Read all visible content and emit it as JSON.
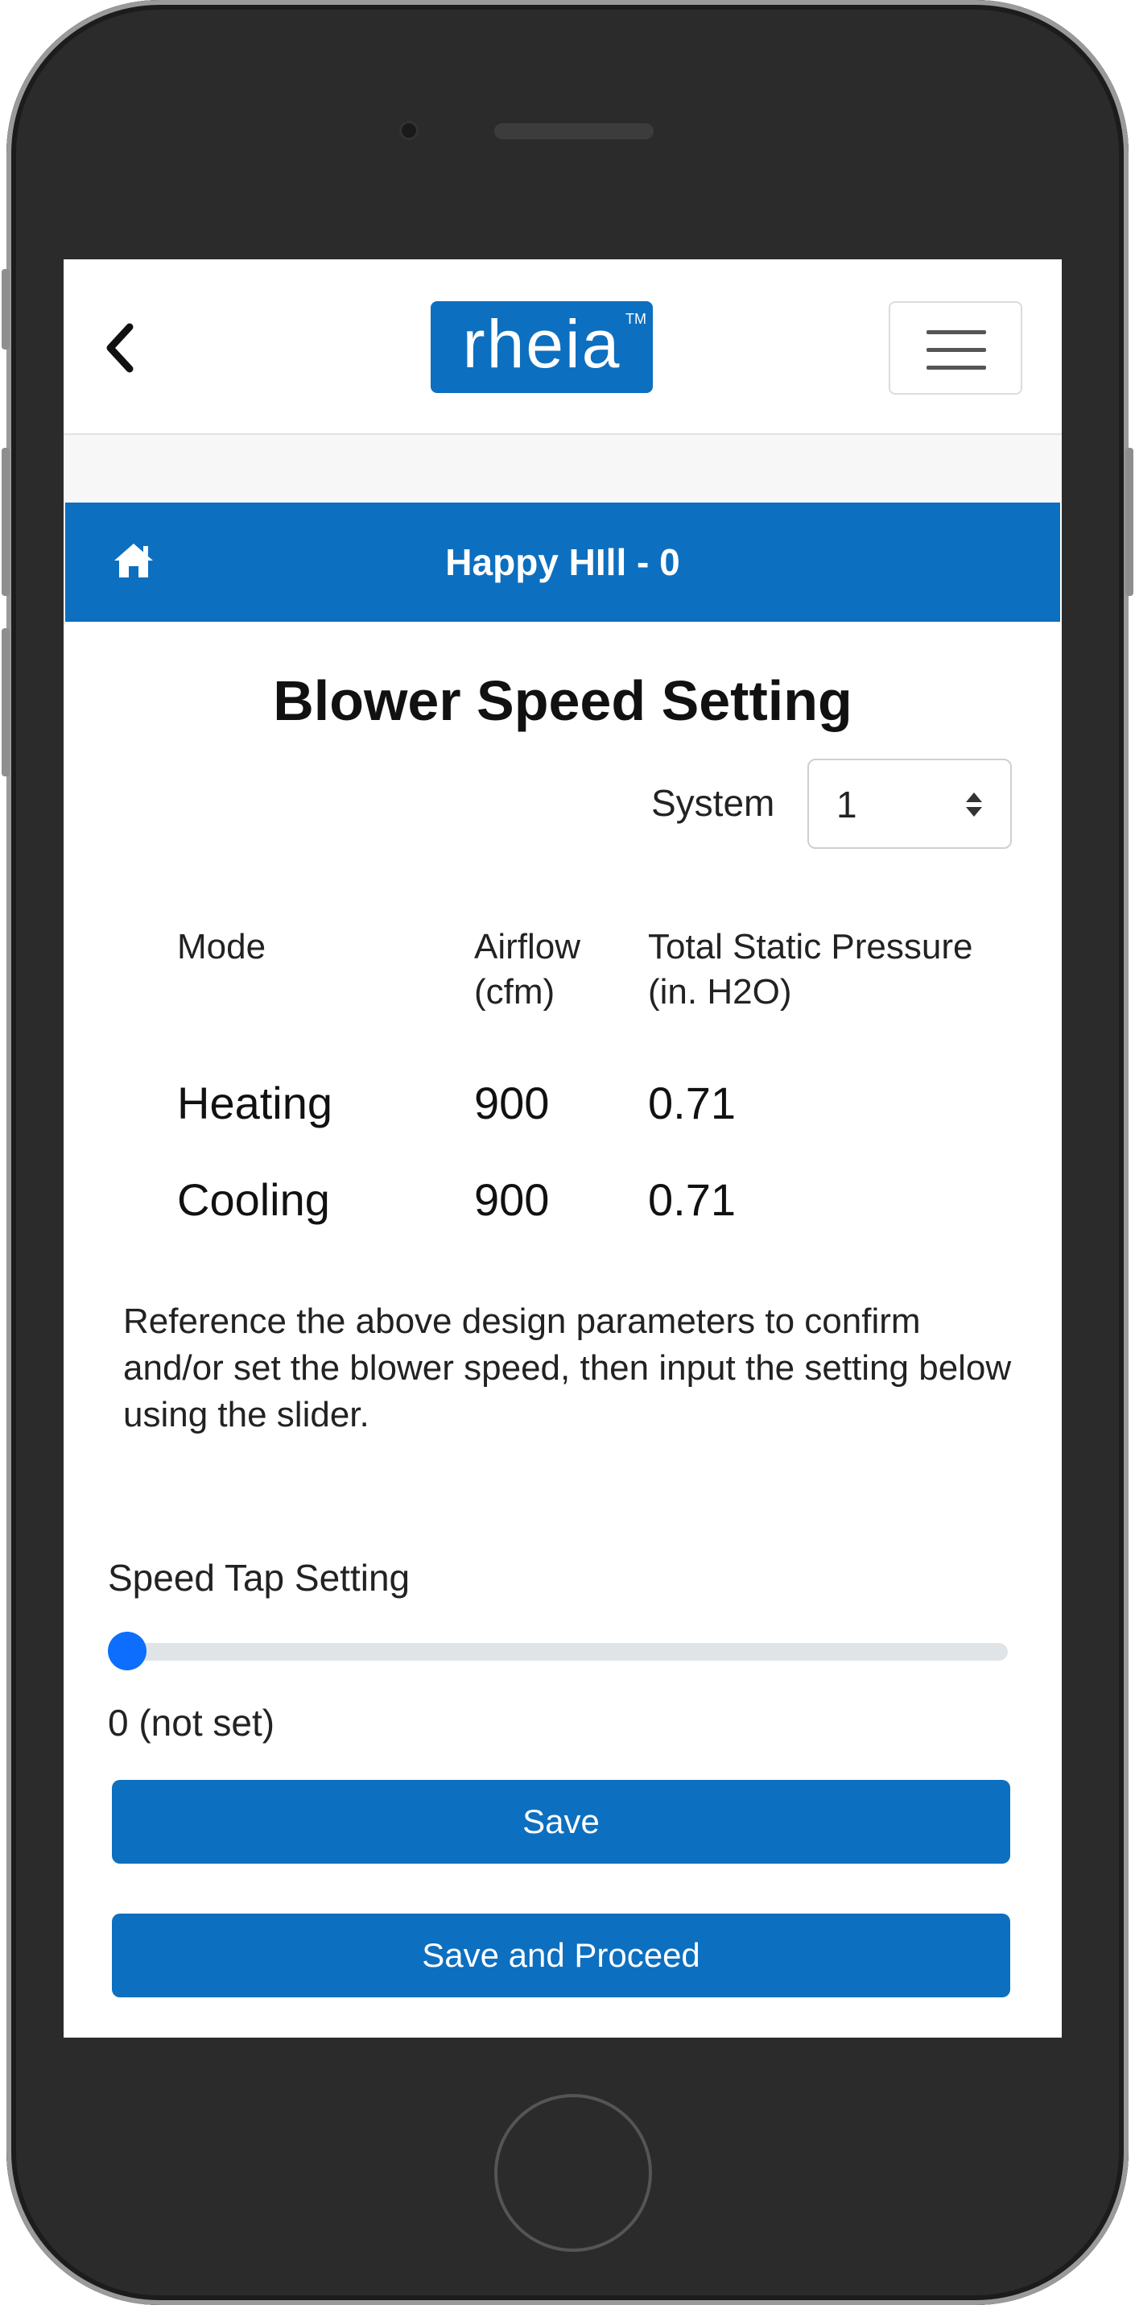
{
  "header": {
    "logo_text": "rheia",
    "logo_tm": "TM",
    "site_name": "Happy HIll - 0"
  },
  "page": {
    "title": "Blower Speed Setting",
    "system_label": "System",
    "system_value": "1"
  },
  "table": {
    "headers": [
      {
        "line1": "Mode",
        "line2": ""
      },
      {
        "line1": "Airflow",
        "line2": "(cfm)"
      },
      {
        "line1": "Total Static Pressure",
        "line2": "(in. H2O)"
      }
    ],
    "rows": [
      {
        "mode": "Heating",
        "airflow": "900",
        "pressure": "0.71"
      },
      {
        "mode": "Cooling",
        "airflow": "900",
        "pressure": "0.71"
      }
    ]
  },
  "instructions": "Reference the above design parameters to confirm and/or set the blower speed, then input the setting below using the slider.",
  "slider": {
    "label": "Speed Tap Setting",
    "value": 0,
    "value_text": "0 (not set)"
  },
  "buttons": {
    "save": "Save",
    "save_and_proceed": "Save and Proceed"
  },
  "colors": {
    "brand_blue": "#0d6fbf",
    "slider_thumb": "#0d6efd"
  },
  "icons": {
    "back": "chevron-left-icon",
    "menu": "hamburger-icon",
    "home": "home-icon"
  }
}
